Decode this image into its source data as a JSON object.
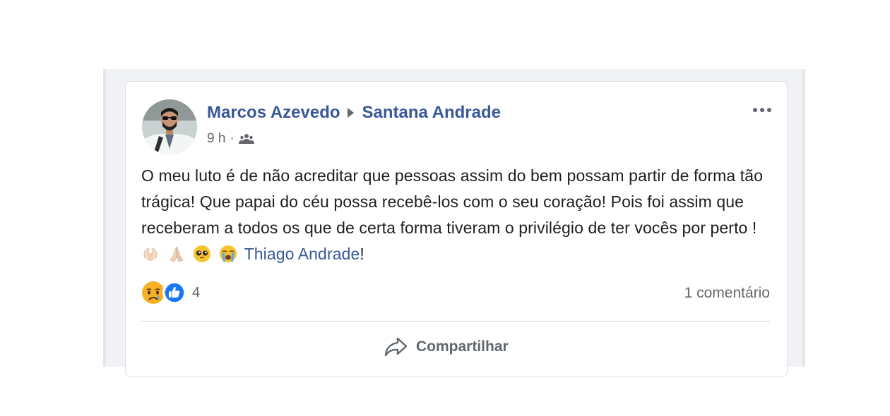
{
  "post": {
    "author": "Marcos Azevedo",
    "target": "Santana Andrade",
    "time": "9 h",
    "separator": "·",
    "audience_icon": "friends-icon",
    "text_before_emojis": "O meu luto é de não acreditar que pessoas assim do bem possam partir de forma tão trágica! Que papai do céu possa recebê-los com o seu coração! Pois foi assim que receberam a todos os que de certa forma tiveram o privilégio de ter vocês por perto !",
    "inline_emojis": [
      "clapping-hands-emoji",
      "praying-hands-emoji",
      "pleading-face-emoji",
      "crying-face-emoji"
    ],
    "mention": "Thiago Andrade",
    "text_after_mention": "!",
    "reactions": {
      "icons": [
        "sad-reaction-icon",
        "like-reaction-icon"
      ],
      "count": "4"
    },
    "comments": "1 comentário",
    "actions": {
      "share_label": "Compartilhar"
    }
  },
  "colors": {
    "link": "#385898",
    "secondary_text": "#65676b",
    "like_blue": "#1877f2",
    "reaction_yellow": "#f7b125"
  }
}
